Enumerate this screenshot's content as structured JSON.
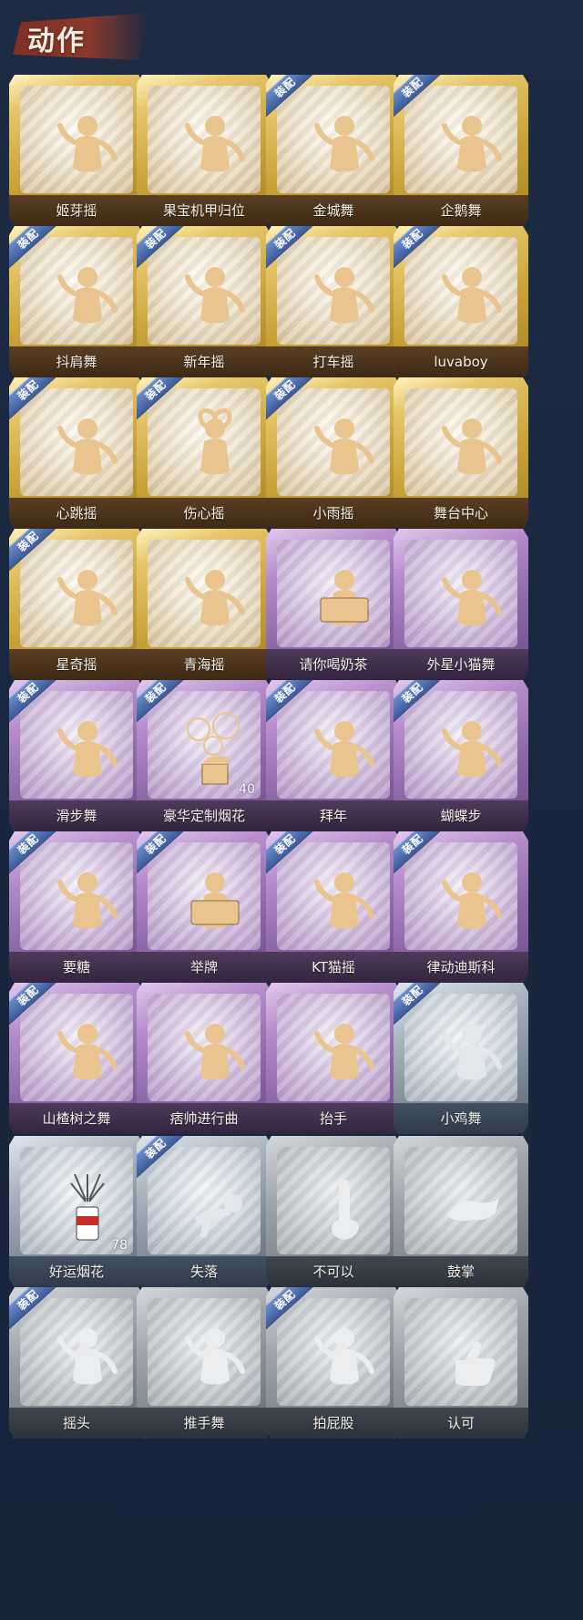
{
  "section": {
    "title": "动作"
  },
  "badge_label": "装配",
  "cards": [
    {
      "label": "姬芽摇",
      "tier": "gold",
      "equipped": false,
      "icon": "dance-figure-icon",
      "count": null
    },
    {
      "label": "果宝机甲归位",
      "tier": "gold",
      "equipped": false,
      "icon": "dance-figure-icon",
      "count": null
    },
    {
      "label": "金城舞",
      "tier": "gold",
      "equipped": true,
      "icon": "dance-figure-icon",
      "count": null
    },
    {
      "label": "企鹅舞",
      "tier": "gold",
      "equipped": true,
      "icon": "dance-figure-icon",
      "count": null
    },
    {
      "label": "抖肩舞",
      "tier": "gold",
      "equipped": true,
      "icon": "dance-figure-icon",
      "count": null
    },
    {
      "label": "新年摇",
      "tier": "gold",
      "equipped": true,
      "icon": "dance-figure-icon",
      "count": null
    },
    {
      "label": "打车摇",
      "tier": "gold",
      "equipped": true,
      "icon": "dance-figure-icon",
      "count": null
    },
    {
      "label": "luvaboy",
      "tier": "gold",
      "equipped": true,
      "icon": "dance-figure-icon",
      "count": null
    },
    {
      "label": "心跳摇",
      "tier": "gold",
      "equipped": true,
      "icon": "heart-dance-icon",
      "count": null
    },
    {
      "label": "伤心摇",
      "tier": "gold",
      "equipped": true,
      "icon": "heart-hands-icon",
      "count": null
    },
    {
      "label": "小雨摇",
      "tier": "gold",
      "equipped": true,
      "icon": "dance-figure-icon",
      "count": null
    },
    {
      "label": "舞台中心",
      "tier": "gold",
      "equipped": false,
      "icon": "dance-figure-icon",
      "count": null
    },
    {
      "label": "星奇摇",
      "tier": "gold",
      "equipped": true,
      "icon": "dance-figure-icon",
      "count": null
    },
    {
      "label": "青海摇",
      "tier": "gold",
      "equipped": false,
      "icon": "dance-figure-icon",
      "count": null
    },
    {
      "label": "请你喝奶茶",
      "tier": "purple",
      "equipped": false,
      "icon": "sign-figure-icon",
      "count": null
    },
    {
      "label": "外星小猫舞",
      "tier": "purple",
      "equipped": false,
      "icon": "dance-figure-icon",
      "count": null
    },
    {
      "label": "滑步舞",
      "tier": "purple",
      "equipped": true,
      "icon": "dance-figure-icon",
      "count": null
    },
    {
      "label": "豪华定制烟花",
      "tier": "purple",
      "equipped": true,
      "icon": "fireworks-box-icon",
      "count": "40"
    },
    {
      "label": "拜年",
      "tier": "purple",
      "equipped": true,
      "icon": "bow-figure-icon",
      "count": null
    },
    {
      "label": "蝴蝶步",
      "tier": "purple",
      "equipped": true,
      "icon": "dance-figure-icon",
      "count": null
    },
    {
      "label": "要糖",
      "tier": "purple",
      "equipped": true,
      "icon": "ask-figure-icon",
      "count": null
    },
    {
      "label": "举牌",
      "tier": "purple",
      "equipped": true,
      "icon": "sign-figure-icon",
      "count": null
    },
    {
      "label": "KT猫摇",
      "tier": "purple",
      "equipped": true,
      "icon": "dance-figure-icon",
      "count": null
    },
    {
      "label": "律动迪斯科",
      "tier": "purple",
      "equipped": true,
      "icon": "disco-figure-icon",
      "count": null
    },
    {
      "label": "山楂树之舞",
      "tier": "purple",
      "equipped": true,
      "icon": "dance-figure-icon",
      "count": null
    },
    {
      "label": "痞帅进行曲",
      "tier": "purple",
      "equipped": false,
      "icon": "dance-figure-icon",
      "count": null
    },
    {
      "label": "抬手",
      "tier": "purple",
      "equipped": false,
      "icon": "raise-hand-icon",
      "count": null
    },
    {
      "label": "小鸡舞",
      "tier": "silver",
      "equipped": true,
      "icon": "chicken-dance-icon",
      "count": null
    },
    {
      "label": "好运烟花",
      "tier": "silver",
      "equipped": false,
      "icon": "firework-can-icon",
      "count": "78"
    },
    {
      "label": "失落",
      "tier": "silver",
      "equipped": true,
      "icon": "crawl-figure-icon",
      "count": null
    },
    {
      "label": "不可以",
      "tier": "gray",
      "equipped": false,
      "icon": "finger-wag-icon",
      "count": null
    },
    {
      "label": "鼓掌",
      "tier": "gray",
      "equipped": false,
      "icon": "clap-hands-icon",
      "count": null
    },
    {
      "label": "摇头",
      "tier": "gray",
      "equipped": true,
      "icon": "shake-head-icon",
      "count": null
    },
    {
      "label": "推手舞",
      "tier": "gray",
      "equipped": false,
      "icon": "push-hands-icon",
      "count": null
    },
    {
      "label": "拍屁股",
      "tier": "gray",
      "equipped": true,
      "icon": "pat-figure-icon",
      "count": null
    },
    {
      "label": "认可",
      "tier": "gray",
      "equipped": false,
      "icon": "thumbs-up-icon",
      "count": null
    }
  ]
}
